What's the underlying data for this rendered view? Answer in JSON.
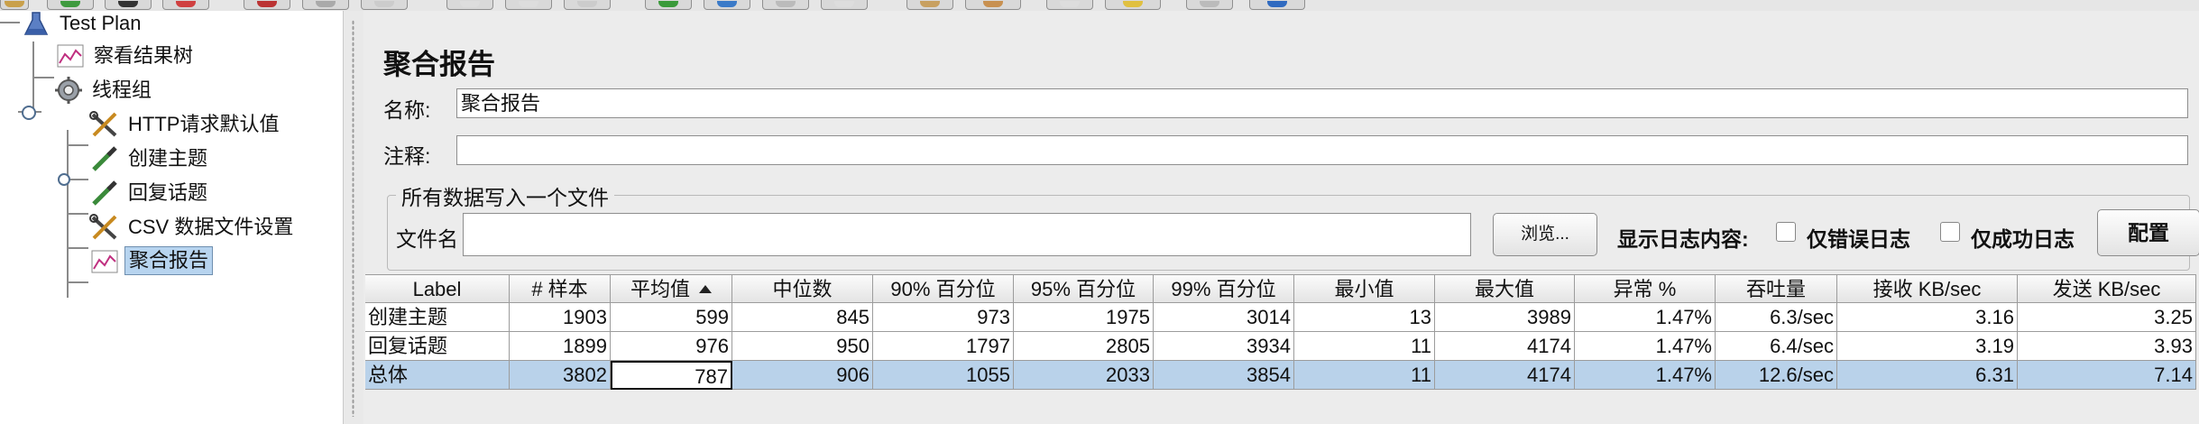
{
  "tree": {
    "items": [
      {
        "label": "Test Plan",
        "icon": "flask-icon"
      },
      {
        "label": "察看结果树",
        "icon": "chart-icon"
      },
      {
        "label": "线程组",
        "icon": "gear-icon"
      },
      {
        "label": "HTTP请求默认值",
        "icon": "tools-icon"
      },
      {
        "label": "创建主题",
        "icon": "pipette-icon"
      },
      {
        "label": "回复话题",
        "icon": "pipette-icon"
      },
      {
        "label": "CSV 数据文件设置",
        "icon": "tools-icon"
      },
      {
        "label": "聚合报告",
        "icon": "chart-icon"
      }
    ]
  },
  "panel": {
    "title": "聚合报告",
    "name_label": "名称:",
    "name_value": "聚合报告",
    "comment_label": "注释:",
    "comment_value": "",
    "group_title": "所有数据写入一个文件",
    "file_label": "文件名",
    "file_value": "",
    "browse_label": "浏览...",
    "log_label": "显示日志内容:",
    "errors_only_label": "仅错误日志",
    "success_only_label": "仅成功日志",
    "config_label": "配置"
  },
  "table": {
    "columns": [
      "Label",
      "# 样本",
      "平均值",
      "中位数",
      "90% 百分位",
      "95% 百分位",
      "99% 百分位",
      "最小值",
      "最大值",
      "异常 %",
      "吞吐量",
      "接收 KB/sec",
      "发送 KB/sec"
    ],
    "rows": [
      [
        "创建主题",
        "1903",
        "599",
        "845",
        "973",
        "1975",
        "3014",
        "13",
        "3989",
        "1.47%",
        "6.3/sec",
        "3.16",
        "3.25"
      ],
      [
        "回复话题",
        "1899",
        "976",
        "950",
        "1797",
        "2805",
        "3934",
        "11",
        "4174",
        "1.47%",
        "6.4/sec",
        "3.19",
        "3.93"
      ],
      [
        "总体",
        "3802",
        "787",
        "906",
        "1055",
        "2033",
        "3854",
        "11",
        "4174",
        "1.47%",
        "12.6/sec",
        "6.31",
        "7.14"
      ]
    ]
  },
  "colors": {
    "selection": "#b9d2ea",
    "tree_selection": "#b7d4ef"
  }
}
